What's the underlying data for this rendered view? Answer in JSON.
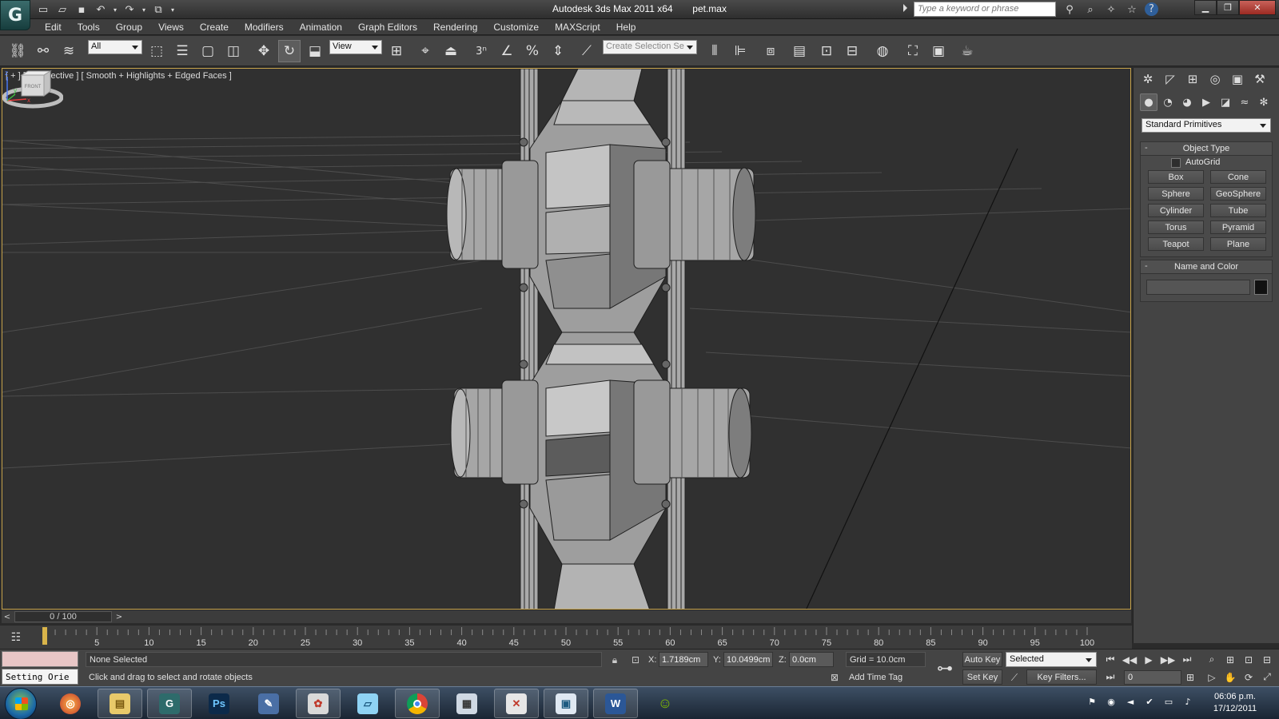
{
  "window": {
    "app_name": "Autodesk 3ds Max  2011 x64",
    "file_name": "pet.max",
    "search_placeholder": "Type a keyword or phrase"
  },
  "menu": [
    "Edit",
    "Tools",
    "Group",
    "Views",
    "Create",
    "Modifiers",
    "Animation",
    "Graph Editors",
    "Rendering",
    "Customize",
    "MAXScript",
    "Help"
  ],
  "toolbar": {
    "selection_filter": "All",
    "ref_coord_system": "View",
    "snap_label": "3",
    "named_selection_placeholder": "Create Selection Se"
  },
  "viewport": {
    "label": "[ + ] [ Perspective ] [ Smooth + Highlights + Edged Faces ]",
    "viewcube_label": "FRONT"
  },
  "command_panel": {
    "primitive_category": "Standard Primitives",
    "object_type": {
      "title": "Object Type",
      "autogrid_label": "AutoGrid",
      "autogrid_checked": false,
      "buttons": [
        "Box",
        "Cone",
        "Sphere",
        "GeoSphere",
        "Cylinder",
        "Tube",
        "Torus",
        "Pyramid",
        "Teapot",
        "Plane"
      ]
    },
    "name_and_color": {
      "title": "Name and Color",
      "name_value": "",
      "color": "#111111"
    }
  },
  "time_slider": {
    "position_label": "0 / 100",
    "prev_label": "<",
    "next_label": ">"
  },
  "track_bar": {
    "tick_labels": [
      "5",
      "10",
      "15",
      "20",
      "25",
      "30",
      "35",
      "40",
      "45",
      "50",
      "55",
      "60",
      "65",
      "70",
      "75",
      "80",
      "85",
      "90",
      "95",
      "100"
    ]
  },
  "status": {
    "listener_text": "Setting Orie",
    "selection_status": "None Selected",
    "prompt": "Click and drag to select and rotate objects",
    "x_label": "X:",
    "x_value": "1.7189cm",
    "y_label": "Y:",
    "y_value": "10.0499cm",
    "z_label": "Z:",
    "z_value": "0.0cm",
    "grid": "Grid = 10.0cm",
    "add_time_tag": "Add Time Tag",
    "auto_key": "Auto Key",
    "set_key": "Set Key",
    "key_mode": "Selected",
    "key_filters": "Key Filters...",
    "current_frame": "0"
  },
  "taskbar": {
    "apps": [
      "windows-explorer",
      "3ds-max",
      "photoshop",
      "script-editor",
      "paint",
      "notebook",
      "chrome",
      "calculator",
      "tool-app",
      "window-app",
      "word",
      "messenger"
    ],
    "photoshop_label": "Ps",
    "clock_time": "06:06 p.m.",
    "clock_date": "17/12/2011"
  },
  "colors": {
    "viewport_bg": "#303030",
    "active_border": "#c6a24b",
    "listener_pink": "#e8c6c6"
  }
}
